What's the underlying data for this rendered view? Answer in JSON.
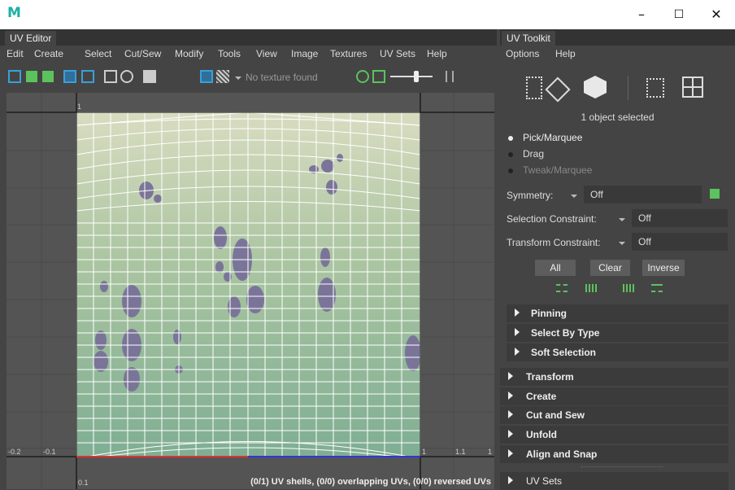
{
  "window": {
    "logo_letter": "M",
    "minimize": "–",
    "maximize": "☐",
    "close": "✕"
  },
  "uv_editor": {
    "tab": "UV Editor",
    "menu": [
      "Edit",
      "Create",
      "Select",
      "Cut/Sew",
      "Modify",
      "Tools",
      "View",
      "Image",
      "Textures",
      "UV Sets",
      "Help"
    ],
    "texture_dropdown": "No texture found",
    "axis_labels": {
      "top": "1",
      "left_minus2": "-0.2",
      "left_minus1": "-0.1",
      "right_1": "1",
      "right_11": "1.1",
      "right_edge": "1",
      "bottom": "0.1"
    },
    "status": "(0/1) UV shells, (0/0) overlapping UVs, (0/0) reversed UVs"
  },
  "uv_toolkit": {
    "tab": "UV Toolkit",
    "menu": [
      "Options",
      "Help"
    ],
    "selection_info": "1 object selected",
    "pick_modes": [
      {
        "label": "Pick/Marquee",
        "active": true
      },
      {
        "label": "Drag",
        "active": false
      },
      {
        "label": "Tweak/Marquee",
        "active": false
      }
    ],
    "symmetry_label": "Symmetry:",
    "symmetry_value": "Off",
    "selection_constraint_label": "Selection Constraint:",
    "selection_constraint_value": "Off",
    "transform_constraint_label": "Transform Constraint:",
    "transform_constraint_value": "Off",
    "buttons": {
      "all": "All",
      "clear": "Clear",
      "inverse": "Inverse"
    },
    "subsections": [
      "Pinning",
      "Select By Type",
      "Soft Selection"
    ],
    "sections": [
      "Transform",
      "Create",
      "Cut and Sew",
      "Unfold",
      "Align and Snap",
      "UV Sets"
    ]
  },
  "colors": {
    "accent_teal": "#1ab0a6",
    "icon_blue": "#3aa0d8",
    "icon_green": "#5cc25c"
  }
}
